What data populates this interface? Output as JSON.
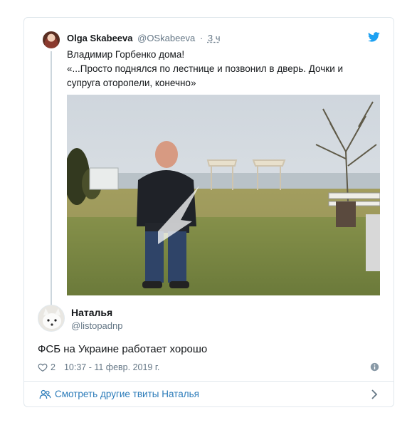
{
  "quoted_tweet": {
    "author_name": "Olga Skabeeva",
    "author_handle": "@OSkabeeva",
    "separator": "·",
    "time": "3 ч",
    "text_line1": "Владимир Горбенко дома!",
    "text_line2": "«...Просто поднялся по лестнице и позвонил в дверь. Дочки и",
    "text_line3": "супруга оторопели, конечно»"
  },
  "tweet": {
    "author_name": "Наталья",
    "author_handle": "@listopadnp",
    "text": "ФСБ на Украине работает хорошо",
    "likes": "2",
    "timestamp": "10:37 - 11 февр. 2019 г."
  },
  "footer": {
    "more_tweets_label": "Смотреть другие твиты Наталья"
  },
  "icons": {
    "brand": "twitter-bird-icon",
    "like": "heart-icon",
    "info": "info-icon",
    "people": "people-icon",
    "chevron": "chevron-right-icon"
  },
  "colors": {
    "twitter_blue": "#1da1f2",
    "link_blue": "#2b7bb9",
    "secondary_text": "#657786",
    "border": "#e1e8ed"
  }
}
